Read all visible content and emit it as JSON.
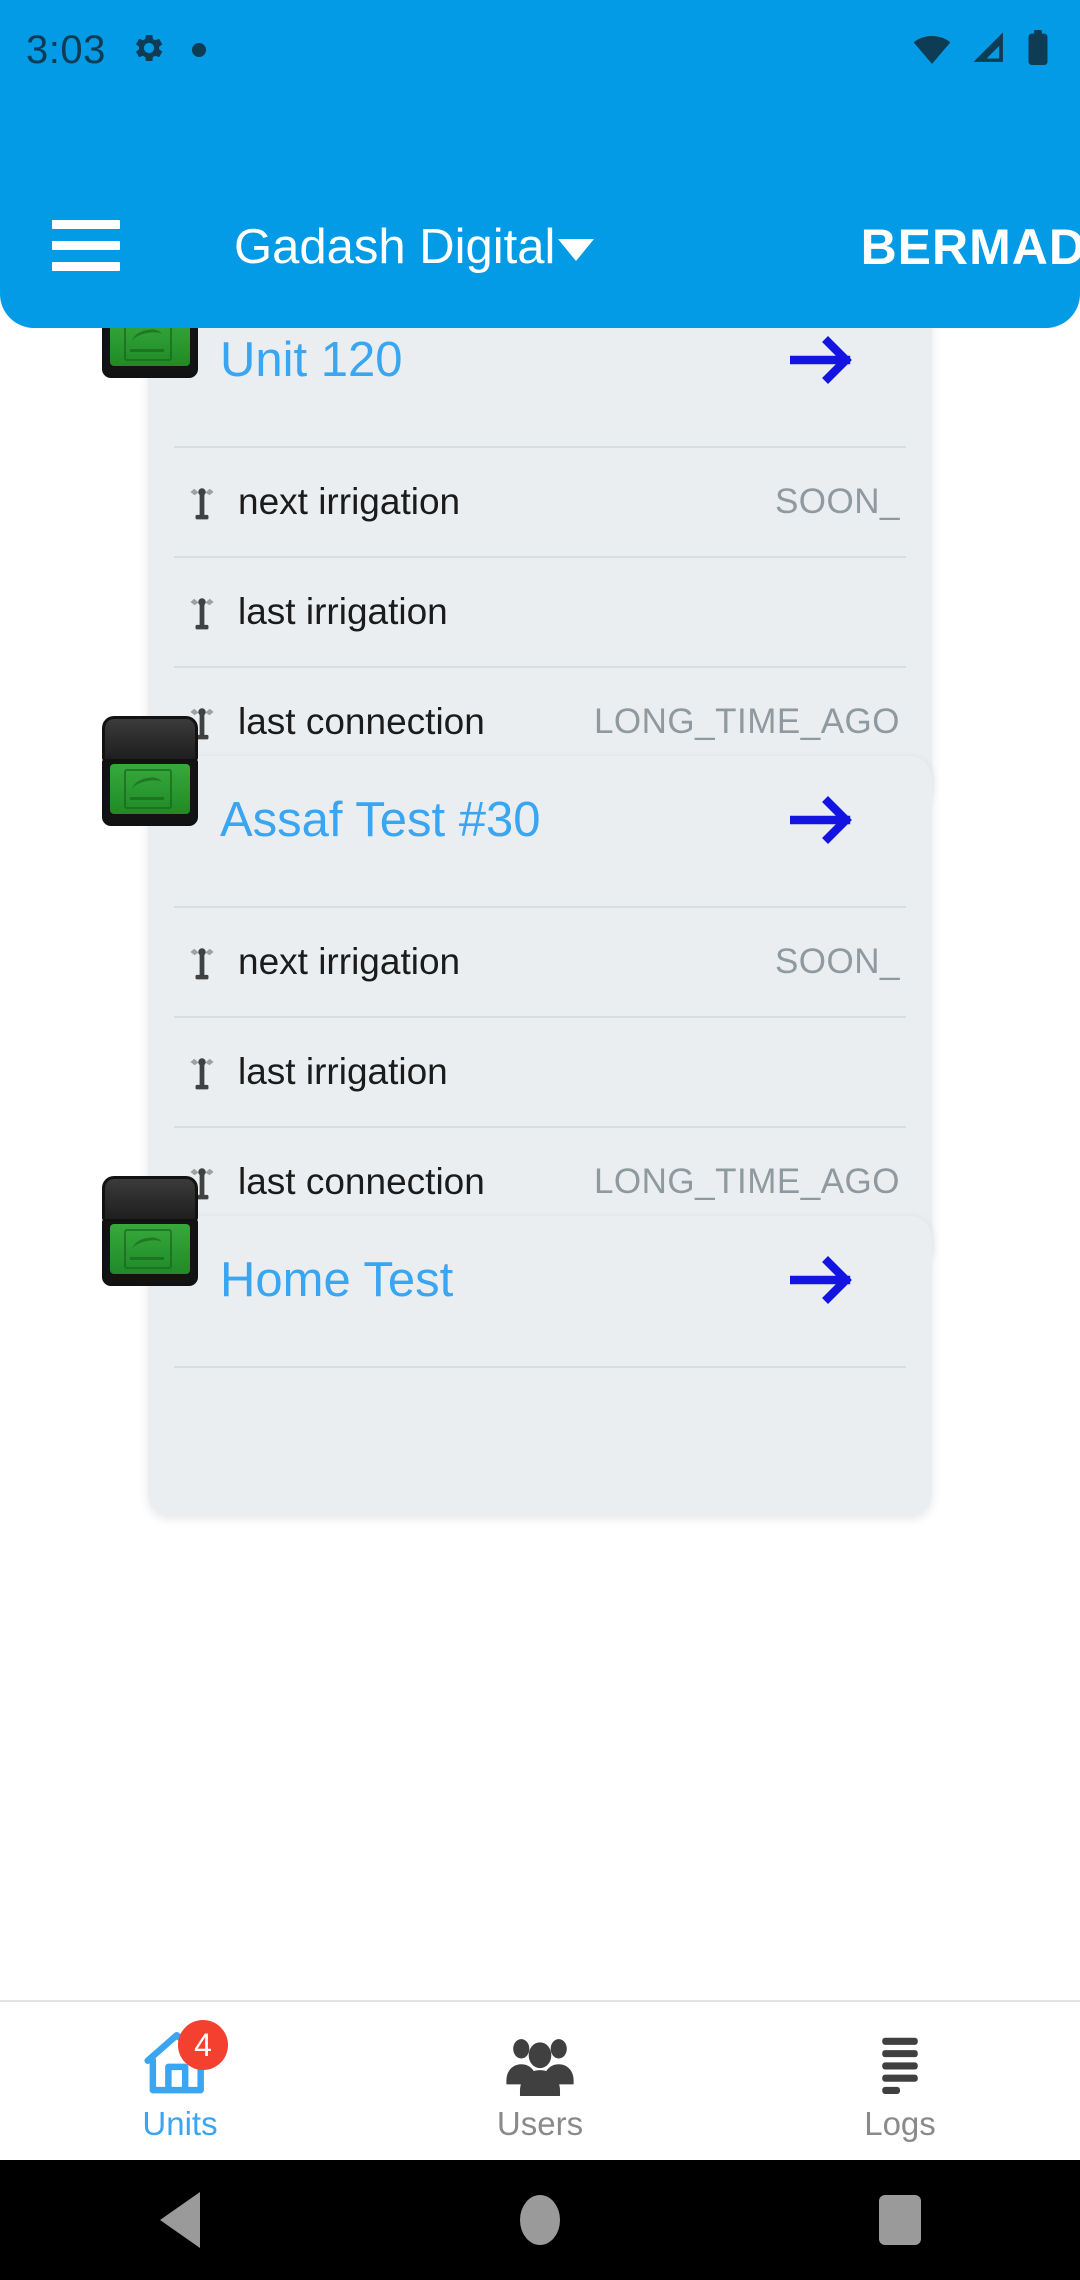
{
  "status_bar": {
    "time": "3:03",
    "icons_left": [
      "gear-icon",
      "dot-indicator"
    ],
    "icons_right": [
      "wifi-icon",
      "cellular-signal-icon",
      "battery-icon"
    ]
  },
  "app_bar": {
    "menu_icon": "hamburger-menu-icon",
    "title": "Gadash Digital",
    "title_caret": "chevron-down-icon",
    "brand": "BERMAD",
    "background_color": "#039BE5"
  },
  "row_labels": {
    "next_irrigation": "next irrigation",
    "last_irrigation": "last irrigation",
    "last_connection": "last connection"
  },
  "units": [
    {
      "name": "Unit 120",
      "arrow": "arrow-right-icon",
      "rows": [
        {
          "label": "next irrigation",
          "value": "SOON_"
        },
        {
          "label": "last irrigation",
          "value": ""
        },
        {
          "label": "last connection",
          "value": "LONG_TIME_AGO"
        }
      ]
    },
    {
      "name": "Assaf Test #30",
      "arrow": "arrow-right-icon",
      "rows": [
        {
          "label": "next irrigation",
          "value": "SOON_"
        },
        {
          "label": "last irrigation",
          "value": ""
        },
        {
          "label": "last connection",
          "value": "LONG_TIME_AGO"
        }
      ]
    },
    {
      "name": "Home Test",
      "arrow": "arrow-right-icon",
      "rows": []
    }
  ],
  "bottom_nav": {
    "items": [
      {
        "label": "Units",
        "icon": "home-icon",
        "badge": "4",
        "active": true
      },
      {
        "label": "Users",
        "icon": "people-group-icon",
        "badge": "",
        "active": false
      },
      {
        "label": "Logs",
        "icon": "list-lines-icon",
        "badge": "",
        "active": false
      }
    ]
  },
  "android_nav": {
    "back": "back-triangle-icon",
    "home": "home-circle-icon",
    "recents": "recents-square-icon"
  },
  "colors": {
    "accent_blue": "#039BE5",
    "title_blue": "#3aa5f0",
    "arrow_blue": "#1414e0",
    "card_bg": "#eaeef0",
    "badge_red": "#f4402f",
    "device_green": "#2f9e35"
  }
}
